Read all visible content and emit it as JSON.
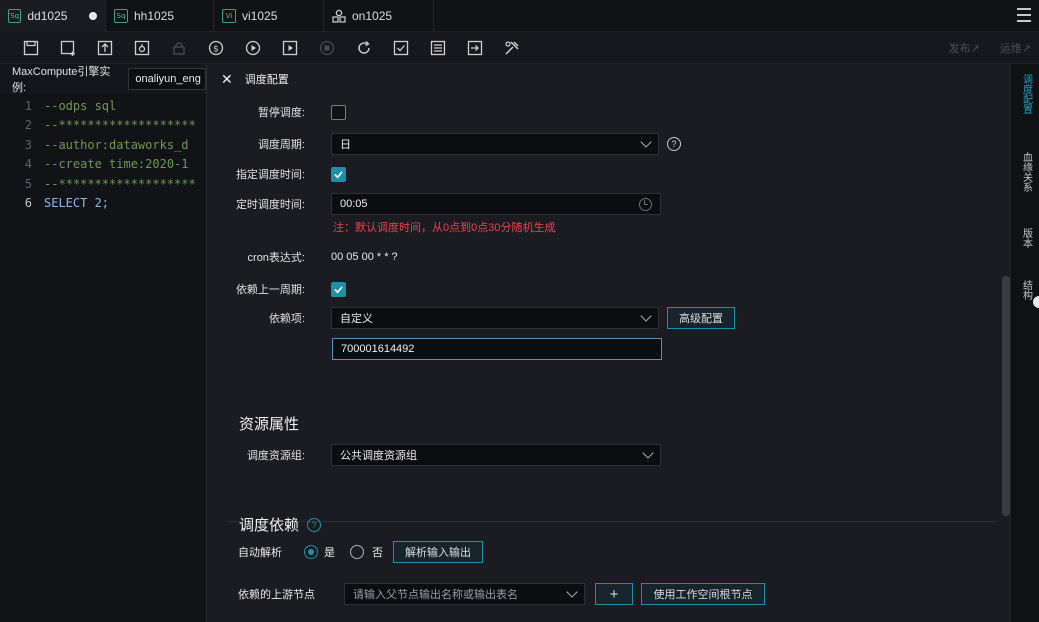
{
  "tabs": [
    {
      "badge": "Sq",
      "title": "dd1025",
      "active": true,
      "unsaved": true
    },
    {
      "badge": "Sq",
      "title": "hh1025",
      "active": false
    },
    {
      "badge": "Vi",
      "title": "vi1025",
      "active": false
    },
    {
      "badge": "",
      "title": "on1025",
      "active": false,
      "icon": "user-group-icon"
    }
  ],
  "toolbar": {
    "buttons": [
      "save-icon",
      "save-as-icon",
      "upload-icon",
      "steal-lock-icon",
      "lock-icon",
      "cost-estimate-icon",
      "run-icon",
      "run-with-params-icon",
      "stop-icon",
      "reload-icon",
      "format-icon",
      "code-review-icon",
      "deploy-icon",
      "tools-icon"
    ],
    "publish_label": "发布↗",
    "ops_label": "运维↗"
  },
  "editor": {
    "engine_label": "MaxCompute引擎实例:",
    "engine_value": "onaliyun_eng",
    "lines": [
      {
        "n": "1",
        "text": "--odps sql"
      },
      {
        "n": "2",
        "text": "--*******************"
      },
      {
        "n": "3",
        "text": "--author:dataworks_d"
      },
      {
        "n": "4",
        "text": "--create time:2020-1"
      },
      {
        "n": "5",
        "text": "--*******************"
      },
      {
        "n": "6",
        "text": "SELECT 2;"
      }
    ]
  },
  "panel": {
    "title": "调度配置",
    "pause_label": "暂停调度:",
    "period_label": "调度周期:",
    "period_value": "日",
    "specify_time_label": "指定调度时间:",
    "timed_label": "定时调度时间:",
    "timed_value": "00:05",
    "timed_note": "注：默认调度时间，从0点到0点30分随机生成",
    "cron_label": "cron表达式:",
    "cron_value": "00 05 00 * * ?",
    "depend_prev_label": "依赖上一周期:",
    "depend_item_label": "依赖项:",
    "depend_item_value": "自定义",
    "advanced_button": "高级配置",
    "depend_input_value": "700001614492",
    "resource_section": "资源属性",
    "resource_group_label": "调度资源组:",
    "resource_group_value": "公共调度资源组",
    "dependency_section": "调度依赖",
    "auto_parse_label": "自动解析",
    "yes_label": "是",
    "no_label": "否",
    "parse_button": "解析输入输出",
    "upstream_label": "依赖的上游节点",
    "upstream_placeholder": "请输入父节点输出名称或输出表名",
    "add_button": "+",
    "root_button": "使用工作空间根节点"
  },
  "rail": {
    "items": [
      "调度配置",
      "血缘关系",
      "版本",
      "结构"
    ]
  },
  "colors": {
    "accent": "#1f8fa6",
    "warning": "#e8434b"
  }
}
